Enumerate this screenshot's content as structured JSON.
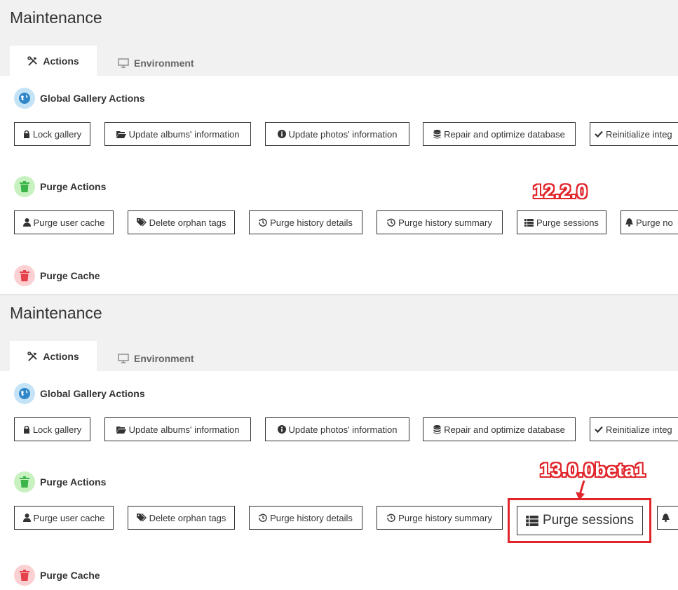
{
  "top": {
    "page_title": "Maintenance",
    "tabs": [
      {
        "label": "Actions"
      },
      {
        "label": "Environment"
      }
    ],
    "sections": {
      "global": {
        "heading": "Global Gallery Actions"
      },
      "purge": {
        "heading": "Purge Actions"
      },
      "cache": {
        "heading": "Purge Cache"
      }
    },
    "global_buttons": [
      {
        "label": "Lock gallery"
      },
      {
        "label": "Update albums' information"
      },
      {
        "label": "Update photos' information"
      },
      {
        "label": "Repair and optimize database"
      },
      {
        "label": "Reinitialize integ"
      }
    ],
    "purge_buttons": [
      {
        "label": "Purge user cache"
      },
      {
        "label": "Delete orphan tags"
      },
      {
        "label": "Purge history details"
      },
      {
        "label": "Purge history summary"
      },
      {
        "label": "Purge sessions"
      },
      {
        "label": "Purge no"
      }
    ],
    "version_annotation": "12.2.0"
  },
  "bottom": {
    "page_title": "Maintenance",
    "tabs": [
      {
        "label": "Actions"
      },
      {
        "label": "Environment"
      }
    ],
    "sections": {
      "global": {
        "heading": "Global Gallery Actions"
      },
      "purge": {
        "heading": "Purge Actions"
      },
      "cache": {
        "heading": "Purge Cache"
      }
    },
    "global_buttons": [
      {
        "label": "Lock gallery"
      },
      {
        "label": "Update albums' information"
      },
      {
        "label": "Update photos' information"
      },
      {
        "label": "Repair and optimize database"
      },
      {
        "label": "Reinitialize integ"
      }
    ],
    "purge_buttons": [
      {
        "label": "Purge user cache"
      },
      {
        "label": "Delete orphan tags"
      },
      {
        "label": "Purge history details"
      },
      {
        "label": "Purge history summary"
      },
      {
        "label": "Purge sessions"
      }
    ],
    "version_annotation": "13.0.0beta1"
  },
  "colors": {
    "annotation_red": "#e0252b",
    "globe_blue": "#2f86c9",
    "trash_green": "#3bb54a",
    "trash_red": "#e5414a"
  }
}
